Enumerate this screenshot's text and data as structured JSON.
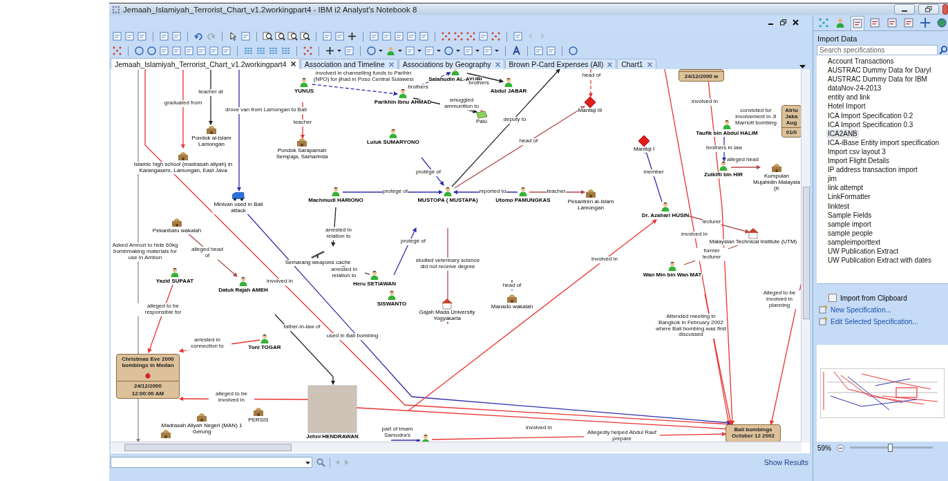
{
  "window": {
    "title": "Jemaah_Islamiyah_Terrorist_Chart_v1.2workingpart4 - IBM i2 Analyst's Notebook 8"
  },
  "tabs": [
    {
      "label": "Jemaah_Islamiyah_Terrorist_Chart_v1.2workingpart4",
      "selected": true
    },
    {
      "label": "Association and Timeline",
      "selected": false
    },
    {
      "label": "Associations by Geography",
      "selected": false
    },
    {
      "label": "Brown P-Card Expenses (All)",
      "selected": false
    },
    {
      "label": "Chart1",
      "selected": false
    }
  ],
  "chart": {
    "nodes": [
      {
        "kind": "person",
        "name": "YUNUS"
      },
      {
        "kind": "person",
        "name": "Parikhin Ibnu AHMAD"
      },
      {
        "kind": "person",
        "name": "Salahudin AL-AYUBI"
      },
      {
        "kind": "person",
        "name": "Abdul JABAR"
      },
      {
        "kind": "diamond",
        "name": "Mantiqi III"
      },
      {
        "kind": "building",
        "name": "Pondok al-Islam",
        "caption": "Lamongan"
      },
      {
        "kind": "building",
        "name": "Pondok Sarapamah",
        "caption": "Sempaja, Samarinda"
      },
      {
        "kind": "person",
        "name": "Luluk SUMARYONO"
      },
      {
        "kind": "map",
        "name": "Palu"
      },
      {
        "kind": "diamond",
        "name": "Mantiqi I"
      },
      {
        "kind": "person",
        "name": "Taufik bin Abdul HALIM"
      },
      {
        "kind": "building",
        "name": "Islamic high school (madrasah aliyah) in Karangasem, Lamongan, East Java"
      },
      {
        "kind": "person",
        "name": "Zulkifli bin HIR"
      },
      {
        "kind": "building",
        "name": "Kumpulan Mujahidin Malaysia (K"
      },
      {
        "kind": "vehicle",
        "name": "Minivan used in Bali attack"
      },
      {
        "kind": "person",
        "name": "Machmudi HARIONO"
      },
      {
        "kind": "person",
        "name": "MUSTOPA ( MUSTAPA)"
      },
      {
        "kind": "person",
        "name": "Utomo PAMUNGKAS"
      },
      {
        "kind": "building",
        "name": "Pesantren al-Islam",
        "caption": "Lamongan"
      },
      {
        "kind": "person",
        "name": "Dr. Azahari HUSIN"
      },
      {
        "kind": "building",
        "name": "Pekanbaru wakalah"
      },
      {
        "kind": "house",
        "name": "Malaysian Technical Institute (UTM)"
      },
      {
        "kind": "person",
        "name": "Yazid SUPAAT"
      },
      {
        "kind": "person",
        "name": "Datuk Rajah AMEH"
      },
      {
        "kind": "weapon",
        "name": "Semarang weapons cache"
      },
      {
        "kind": "person",
        "name": "Heru SETIAWAN"
      },
      {
        "kind": "person",
        "name": "Wan Min bin Wan MAT"
      },
      {
        "kind": "person",
        "name": "SISWANTO"
      },
      {
        "kind": "house",
        "name": "Gajah Mada University",
        "caption": "Yogyakarta"
      },
      {
        "kind": "building",
        "name": "Manado wakalah"
      },
      {
        "kind": "person",
        "name": "Toni TOGAR"
      },
      {
        "kind": "building"
      },
      {
        "kind": "building",
        "name": "Madrasah Aliyah Negeri (MAN) 1",
        "caption": "Gerung"
      },
      {
        "kind": "building",
        "name": "PERSIS"
      },
      {
        "kind": "photo",
        "name": "Jehni HENDRAWAN"
      },
      {
        "kind": "person"
      }
    ],
    "events": [
      {
        "lines": [
          "Christmas Eve 2000",
          "bombings in Medan"
        ],
        "date": "24/12/2000",
        "time": "12:00:00 AM"
      },
      {
        "lines": [
          "Bali bombings",
          "October 12 2002"
        ]
      },
      {
        "date": "24/12/2000 w"
      },
      {
        "lines": [
          "Atriu",
          "Jaka",
          "Aug"
        ],
        "date": "01/0"
      }
    ],
    "links": [
      {
        "label": "Asked Amrozi to hide 60kg bombmaking materials for use in Ambon",
        "kind": "grey"
      },
      {
        "label": "involved in",
        "kind": "red"
      },
      {
        "label": "graduated from",
        "kind": "red"
      },
      {
        "label": "teacher at",
        "kind": "black"
      },
      {
        "label": "drove van from Lamongan to Bali",
        "kind": "blue"
      },
      {
        "label": "deputy to",
        "kind": "black"
      },
      {
        "label": "head of",
        "kind": "red-dashed"
      },
      {
        "label": "involved in",
        "kind": "red"
      },
      {
        "label": "brothers",
        "kind": "blue-dashed"
      },
      {
        "label": "brothers",
        "kind": "black"
      },
      {
        "label": "involved in",
        "kind": "red"
      },
      {
        "label": "involved in channelling funds to Parihin (NPO) for jihad in Poso Central Sulawesi",
        "kind": "blue-dashed"
      },
      {
        "label": "smuggled ammunition to",
        "kind": "black"
      },
      {
        "label": "teacher",
        "kind": "red"
      },
      {
        "label": "head of",
        "kind": "brown"
      },
      {
        "label": "convicted for involvement in JI Marriott bombing",
        "kind": "red"
      },
      {
        "label": "brothers in law",
        "kind": "blue"
      },
      {
        "label": "member",
        "kind": "blue"
      },
      {
        "label": "protégé of",
        "kind": "blue"
      },
      {
        "label": "alleged head",
        "kind": "brown"
      },
      {
        "label": "protégé of",
        "kind": "blue"
      },
      {
        "label": "reported to",
        "kind": "blue"
      },
      {
        "label": "teacher",
        "kind": "brown"
      },
      {
        "label": "arrested in relation to",
        "kind": "black"
      },
      {
        "label": "used in Bali bombing",
        "kind": "blue"
      },
      {
        "label": "lecturer",
        "kind": "brown"
      },
      {
        "label": "involved in",
        "kind": "red"
      },
      {
        "label": "protégé of",
        "kind": "blue"
      },
      {
        "label": "studied veterinary science did not receive degree",
        "kind": "brown"
      },
      {
        "label": "alleged head of",
        "kind": "brown"
      },
      {
        "label": "former lecturer",
        "kind": "brown"
      },
      {
        "label": "arrested in relation to",
        "kind": "black"
      },
      {
        "label": "head of",
        "kind": "blue"
      },
      {
        "label": "Alleged to be involved in planning",
        "kind": "red"
      },
      {
        "label": "alleged to be responsible for",
        "kind": "red"
      },
      {
        "label": "father-in-law of",
        "kind": "black"
      },
      {
        "label": "Attended meeting in Bangkok in February 2002 where Bali bombing was first discussed",
        "kind": "red"
      },
      {
        "label": "arrested in connection to",
        "kind": "red"
      },
      {
        "label": "alleged to be involved in",
        "kind": "red"
      },
      {
        "label": "involved in",
        "kind": "red"
      },
      {
        "label": "Allegedly helped Abdul Rauf prepare",
        "kind": "red"
      },
      {
        "label": "part of Imam Samudra's",
        "kind": "blue"
      }
    ]
  },
  "find_bar": {
    "action": "Show Results"
  },
  "panel": {
    "title": "Import Data",
    "search": {
      "placeholder": "Search specifications"
    },
    "specifications": [
      {
        "label": "Account Transactions",
        "selected": false
      },
      {
        "label": "AUSTRAC Dummy Data for Daryl",
        "selected": false
      },
      {
        "label": "AUSTRAC Dummy Data for IBM",
        "selected": false
      },
      {
        "label": "dataNov-24-2013",
        "selected": false
      },
      {
        "label": "entity and link",
        "selected": false
      },
      {
        "label": "Hotel Import",
        "selected": false
      },
      {
        "label": "ICA Import Specification 0.2",
        "selected": false
      },
      {
        "label": "ICA Import Specification 0.3",
        "selected": false
      },
      {
        "label": "ICA2ANB",
        "selected": true
      },
      {
        "label": "ICA-iBase Entity import specification",
        "selected": false
      },
      {
        "label": "Import csv layout 3",
        "selected": false
      },
      {
        "label": "Import Flight Details",
        "selected": false
      },
      {
        "label": "IP address transaction import",
        "selected": false
      },
      {
        "label": "jim",
        "selected": false
      },
      {
        "label": "link attempt",
        "selected": false
      },
      {
        "label": "LinkFormatter",
        "selected": false
      },
      {
        "label": "linktest",
        "selected": false
      },
      {
        "label": "Sample Fields",
        "selected": false
      },
      {
        "label": "sample import",
        "selected": false
      },
      {
        "label": "sample people",
        "selected": false
      },
      {
        "label": "sampleimporttext",
        "selected": false
      },
      {
        "label": "UW Publication Extract",
        "selected": false
      },
      {
        "label": "UW Publication Extract with dates",
        "selected": false
      }
    ],
    "clipboard": {
      "label": "Import from Clipboard",
      "checked": false
    },
    "actions": [
      "New Specification...",
      "Edit Selected Specification..."
    ],
    "zoom": {
      "reading": "59%",
      "level": 0.48
    }
  }
}
